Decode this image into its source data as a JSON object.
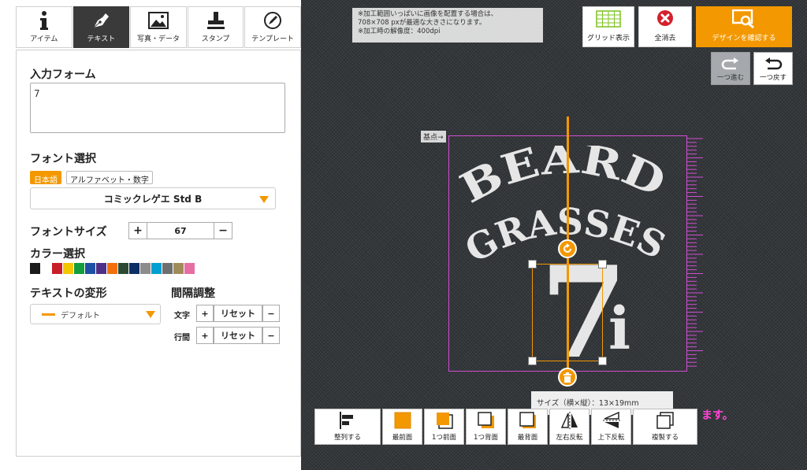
{
  "tabs": [
    {
      "label": "アイテム",
      "icon": "info-icon"
    },
    {
      "label": "テキスト",
      "icon": "pen-icon",
      "active": true
    },
    {
      "label": "写真・データ",
      "icon": "image-icon"
    },
    {
      "label": "スタンプ",
      "icon": "stamp-icon"
    },
    {
      "label": "テンプレート",
      "icon": "template-icon"
    }
  ],
  "form": {
    "input_title": "入力フォーム",
    "input_value": "7",
    "font_title": "フォント選択",
    "lang_japanese": "日本語",
    "lang_alpha": "アルファベット・数字",
    "font_name": "コミックレゲエ Std B",
    "size_title": "フォントサイズ",
    "size_plus": "+",
    "size_value": "67",
    "size_minus": "−",
    "color_title": "カラー選択",
    "colors": [
      "#1a1a1a",
      "#ffffff",
      "#c81e28",
      "#f2c600",
      "#129e3a",
      "#1f4fa5",
      "#4d2f86",
      "#f26f0a",
      "#2c4a33",
      "#0c2f66",
      "#8c8c8c",
      "#00a0d2",
      "#6e6e6e",
      "#a08c5a",
      "#e66ea5"
    ],
    "transform_title": "テキストの変形",
    "transform_value": "デフォルト",
    "spacing_title": "間隔調整",
    "char_label": "文字",
    "line_label": "行間",
    "reset_label": "リセット",
    "plus": "+",
    "minus": "−"
  },
  "canvas": {
    "notice_lines": [
      "※加工範囲いっぱいに画像を配置する場合は、",
      "708×708 pxが最適な大きさになります。",
      "※加工時の解像度：400dpi"
    ],
    "grid_label": "グリッド表示",
    "clear_label": "全消去",
    "confirm_label": "デザインを確認する",
    "redo_label": "一つ進む",
    "undo_label": "一つ戻す",
    "origin_label": "基点→",
    "art_line1": "BEARD",
    "art_line2": "GRASSES",
    "art_number": "7",
    "art_suffix": "i",
    "size_info": "サイズ（横×縦）：13×19mm",
    "pink_note": "ます。"
  },
  "toolbar": [
    {
      "label": "整列する",
      "icon": "align-icon"
    },
    {
      "label": "最前面",
      "icon": "bring-front-icon"
    },
    {
      "label": "1つ前面",
      "icon": "bring-forward-icon"
    },
    {
      "label": "1つ背面",
      "icon": "send-backward-icon"
    },
    {
      "label": "最背面",
      "icon": "send-back-icon"
    },
    {
      "label": "左右反転",
      "icon": "flip-horizontal-icon"
    },
    {
      "label": "上下反転",
      "icon": "flip-vertical-icon"
    },
    {
      "label": "複製する",
      "icon": "duplicate-icon"
    }
  ],
  "accent_color": "#f39800",
  "print_area_color": "#d24cd2"
}
